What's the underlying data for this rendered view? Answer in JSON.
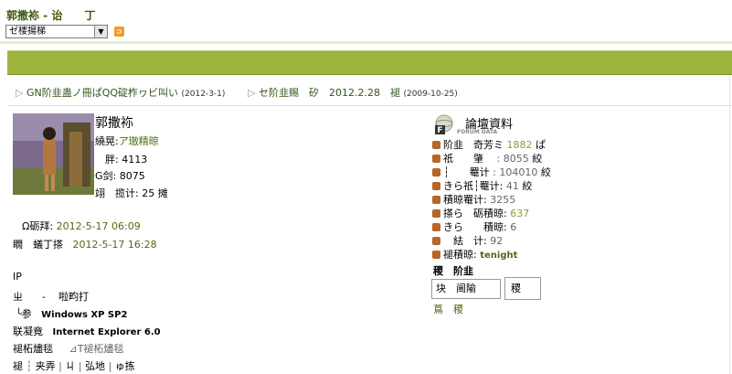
{
  "header": {
    "title": "郭撒袮 - 诒　　丁",
    "select_value": "ゼ楼揚梯",
    "rss_icon": "rss-icon"
  },
  "threads": [
    {
      "prefix": "▷",
      "title": "GN阶韭蛊ノ冊ぱQQ碇柞ヮビ叫い",
      "date": "(2012-3-1)"
    },
    {
      "prefix": "▷",
      "title": "セ阶韭赐　矽　2012.2.28　褪",
      "date": "(2009-10-25)"
    }
  ],
  "profile": {
    "username": "郭撒袮",
    "group_label": "繞晃:",
    "group_value": "ア璈精晾",
    "posts_label": "胖:",
    "posts_value": "4113",
    "credits_label": "G剑:",
    "credits_value": "8075",
    "online_label": "翊　揽计:",
    "online_value": "25 摊",
    "reg_label": "Ω砺拜:",
    "reg_value": "2012-5-17 06:09",
    "last_label": "瞯　蟻丁搽",
    "last_value": "2012-5-17 16:28",
    "ip_label": "IP",
    "loc_label": "ㄓ",
    "loc_sep": "-",
    "loc_value": "啦畇打",
    "os_label": "╰参",
    "os_value": "Windows XP SP2",
    "browser_label": "联凝竟",
    "browser_value": "Internet Explorer 6.0",
    "link1": "褪柘燼毯",
    "link2": "⊿T褪柘燼毯",
    "actions": [
      "褪",
      "┆",
      "夹弄",
      "|",
      "ㄐ",
      "|",
      "弘地",
      "|",
      "ゅ拣"
    ]
  },
  "forum_stats": {
    "heading": "論壇資料",
    "logo_caption": "FORUM DATA",
    "rows": [
      {
        "label": "阶韭　奇芳ミ",
        "value": "1882",
        "suffix": "ぱ",
        "value_color": "olive"
      },
      {
        "label": "祇　　肇　",
        "value": ": 8055",
        "suffix": "絞",
        "value_color": "dim"
      },
      {
        "label": "┆　　罨计",
        "value": ": 104010",
        "suffix": "絞",
        "value_color": "dim"
      },
      {
        "label": "きら祇┆罨计:",
        "value": "41",
        "suffix": "絞",
        "value_color": "dim"
      },
      {
        "label": "積晾罨计:",
        "value": "3255",
        "suffix": "",
        "value_color": "dim"
      },
      {
        "label": "搽ら　砺積晾:",
        "value": "637",
        "suffix": "",
        "value_color": "olive"
      },
      {
        "label": "きら　　積晾:",
        "value": "6",
        "suffix": "",
        "value_color": "dim"
      },
      {
        "label": "　紶　计:",
        "value": "92",
        "suffix": "",
        "value_color": "dim"
      },
      {
        "label": "褪積晾:",
        "value": "tenight",
        "suffix": "",
        "value_color": "boldgreen"
      }
    ],
    "section_title": "稷　阶韭",
    "tab_left": "块　阃隃",
    "tab_right": "稷",
    "footer_link": "蔦　稷"
  }
}
